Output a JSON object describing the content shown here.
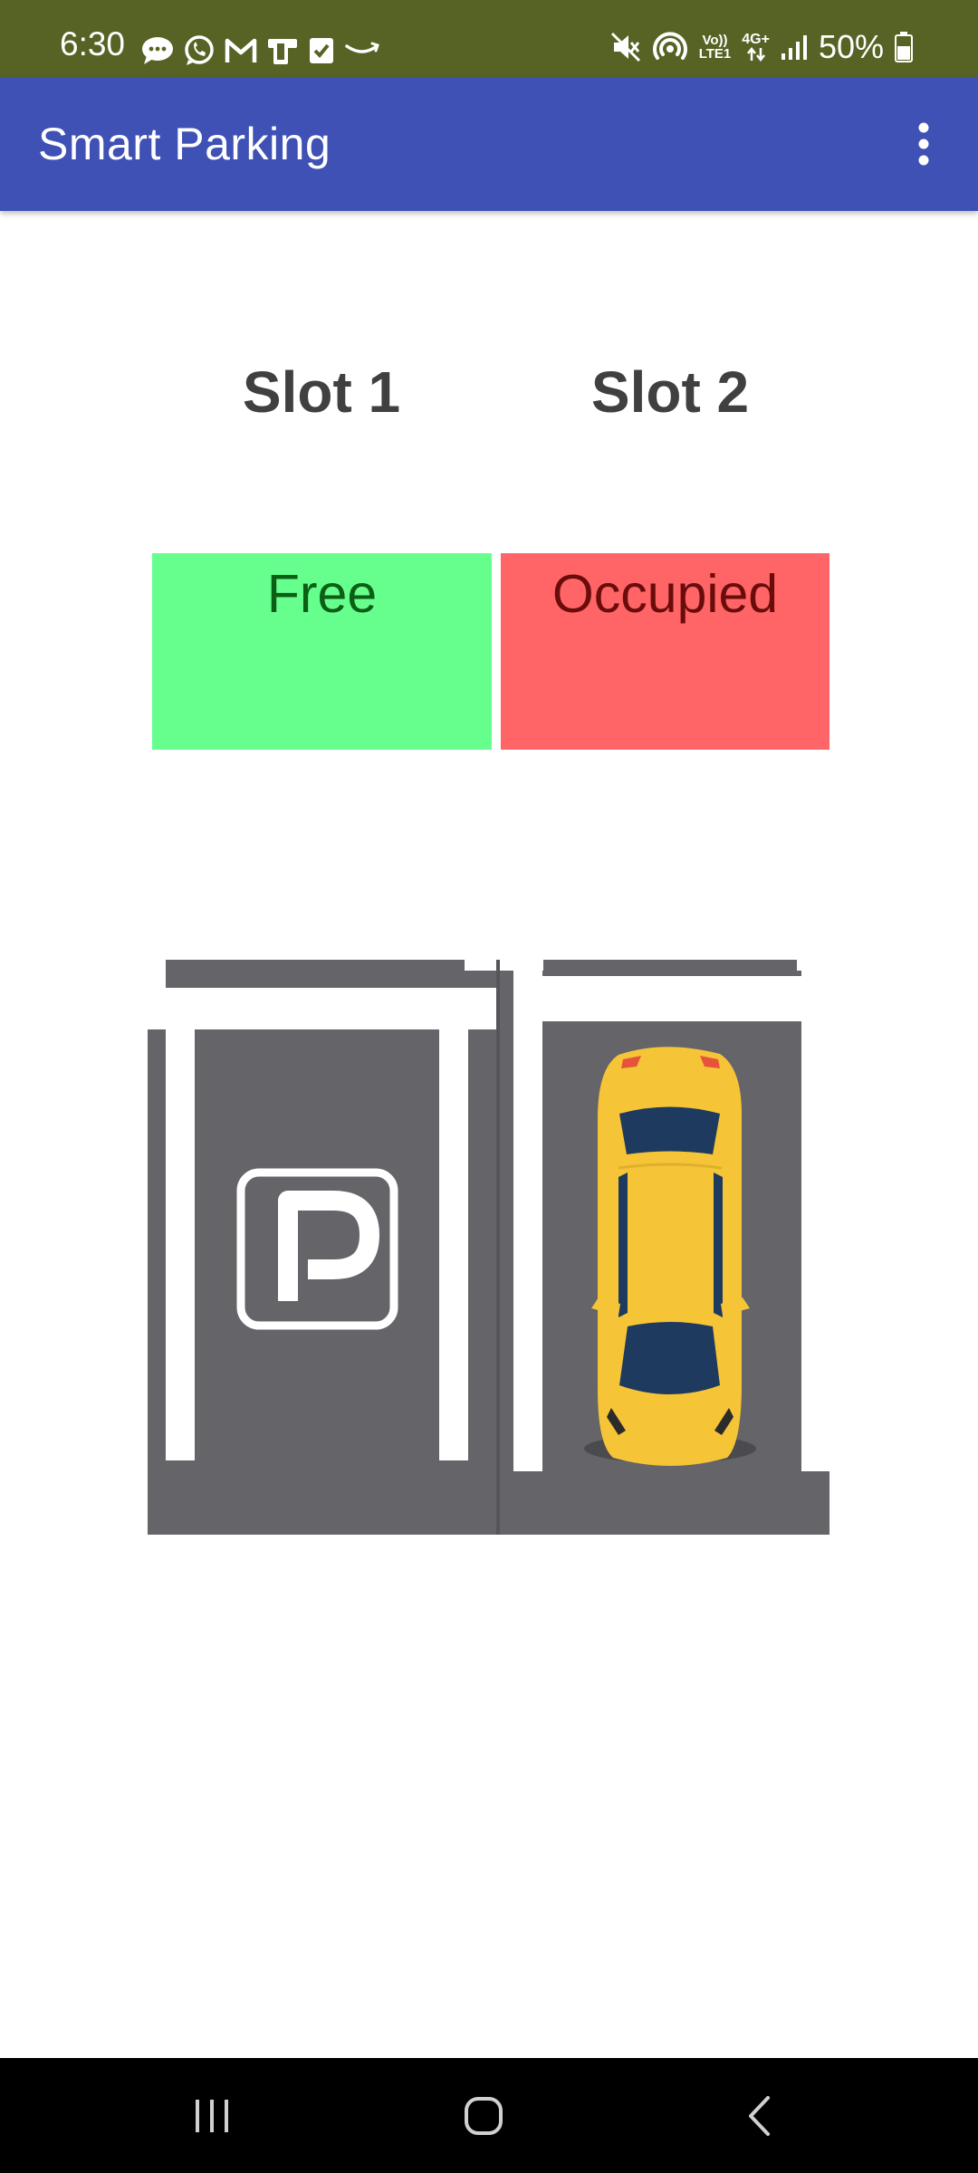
{
  "status_bar": {
    "time": "6:30",
    "battery": "50%",
    "left_icons": [
      "chat-bubble-icon",
      "whatsapp-icon",
      "gmail-icon",
      "device-icon",
      "checklist-icon",
      "amazon-icon"
    ],
    "right_icons": [
      "mute-icon",
      "hotspot-icon",
      "volte-icon",
      "network-4g-icon",
      "signal-icon",
      "battery-icon"
    ],
    "network_label_top": "Vo))",
    "network_label_bottom": "LTE1",
    "net_type": "4G+"
  },
  "app_bar": {
    "title": "Smart Parking",
    "menu_icon": "more-vert-icon",
    "color": "#3f51b5"
  },
  "slots": [
    {
      "header": "Slot 1",
      "status": "Free",
      "color": "#66ff8e"
    },
    {
      "header": "Slot 2",
      "status": "Occupied",
      "color": "#ff6566"
    }
  ],
  "nav_bar": {
    "icons": [
      "recent-apps-icon",
      "home-icon",
      "back-icon"
    ]
  }
}
